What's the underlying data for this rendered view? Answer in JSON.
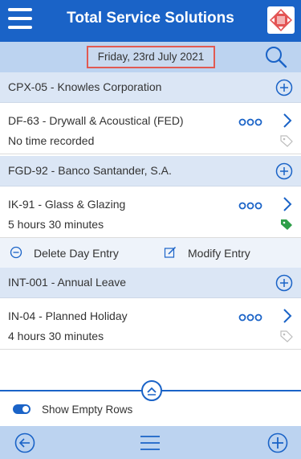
{
  "header": {
    "title": "Total Service Solutions",
    "menu_icon": "hamburger-icon",
    "logo_icon": "app-logo"
  },
  "date_bar": {
    "date": "Friday, 23rd July 2021",
    "search_icon": "search-icon"
  },
  "entries": [
    {
      "group": "CPX-05 - Knowles Corporation",
      "item": "DF-63 - Drywall & Acoustical (FED)",
      "time": "No time recorded",
      "tag_color": "#bdbdbd"
    },
    {
      "group": "FGD-92 - Banco Santander, S.A.",
      "item": "IK-91 - Glass & Glazing",
      "time": "5 hours 30 minutes",
      "tag_color": "#2e9e48"
    },
    {
      "group": "INT-001 - Annual Leave",
      "item": "IN-04 - Planned Holiday",
      "time": "4 hours 30 minutes",
      "tag_color": "#bdbdbd"
    }
  ],
  "actions": {
    "delete": "Delete Day Entry",
    "modify": "Modify Entry"
  },
  "toggle": {
    "label": "Show Empty Rows",
    "on": true
  },
  "footer": {
    "back_icon": "back-arrow-icon",
    "menu_icon": "list-menu-icon",
    "add_icon": "add-circle-icon"
  },
  "colors": {
    "primary": "#1a63c7",
    "date_highlight": "#e15a52"
  }
}
